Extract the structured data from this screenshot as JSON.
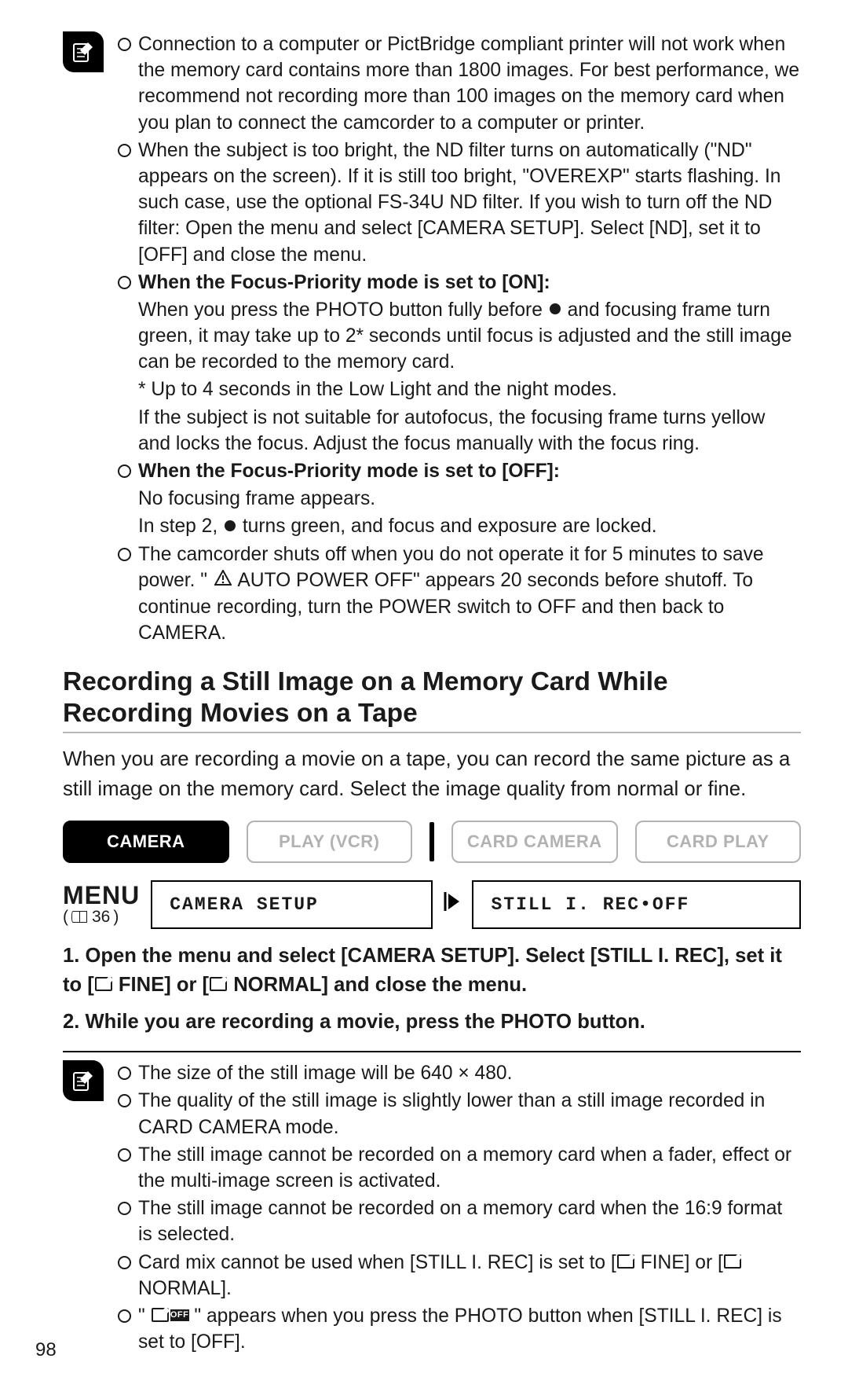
{
  "notes1": {
    "p1": "Connection to a computer or PictBridge compliant printer will not work when the memory card contains more than 1800 images. For best performance, we recommend not recording more than 100 images on the memory card when you plan to connect the camcorder to a computer or printer.",
    "p2": "When the subject is too bright, the ND filter turns on automatically (\"ND\" appears on the screen). If it is still too bright, \"OVEREXP\" starts flashing. In such case, use the optional FS-34U ND filter. If you wish to turn off the ND filter: Open the menu and select [CAMERA SETUP]. Select [ND], set it to [OFF] and close the menu.",
    "p3_bold": "When the Focus-Priority mode is set to [ON]:",
    "p3_a1": "When you press the PHOTO button fully before ",
    "p3_a2": " and focusing frame turn green, it may take up to 2* seconds until focus is adjusted and the still image can be recorded to the memory card.",
    "p3_b": "* Up to 4 seconds in the Low Light and the night modes.",
    "p3_c": "If the subject is not suitable for autofocus, the focusing frame turns yellow and locks the focus. Adjust the focus manually with the focus ring.",
    "p4_bold": "When the Focus-Priority mode is set to [OFF]:",
    "p4_a": "No focusing frame appears.",
    "p4_b1": "In step 2, ",
    "p4_b2": " turns green, and focus and exposure are locked.",
    "p5_a": "The camcorder shuts off when you do not operate it for 5 minutes to save power. \" ",
    "p5_b": " AUTO POWER OFF\" appears 20 seconds before shutoff. To continue recording, turn the POWER switch to OFF and then back to CAMERA."
  },
  "section_title": "Recording a Still Image on a Memory Card While Recording Movies on a Tape",
  "lead": "When you are recording a movie on a tape, you can record the same picture as a still image on the memory card. Select the image quality from normal or fine.",
  "modes": {
    "camera": "CAMERA",
    "play_vcr": "PLAY (VCR)",
    "card_camera": "CARD CAMERA",
    "card_play": "CARD PLAY"
  },
  "menu": {
    "label": "MENU",
    "page_ref": "36",
    "box_a": "CAMERA SETUP",
    "box_b": "STILL I. REC•OFF"
  },
  "steps": {
    "s1a": "1. Open the menu and select [CAMERA SETUP]. Select [STILL I. REC], set it to [",
    "s1b": " FINE] or [",
    "s1c": " NORMAL] and close the menu.",
    "s2": "2. While you are recording a movie, press the PHOTO button."
  },
  "notes2": {
    "p1": "The size of the still image will be 640 × 480.",
    "p2": "The quality of the still image is slightly lower than a still image recorded in CARD CAMERA mode.",
    "p3": "The still image cannot be recorded on a memory card when a fader, effect or the multi-image screen is activated.",
    "p4": "The still image cannot be recorded on a memory card when the 16:9 format is selected.",
    "p5a": "Card mix cannot be used when [STILL I. REC] is set to [",
    "p5b": " FINE] or [",
    "p5c": " NORMAL].",
    "p6a": "\" ",
    "p6b": " \" appears when you press the PHOTO button when [STILL I. REC] is set to [OFF]."
  },
  "page_number": "98",
  "off_label": "OFF"
}
